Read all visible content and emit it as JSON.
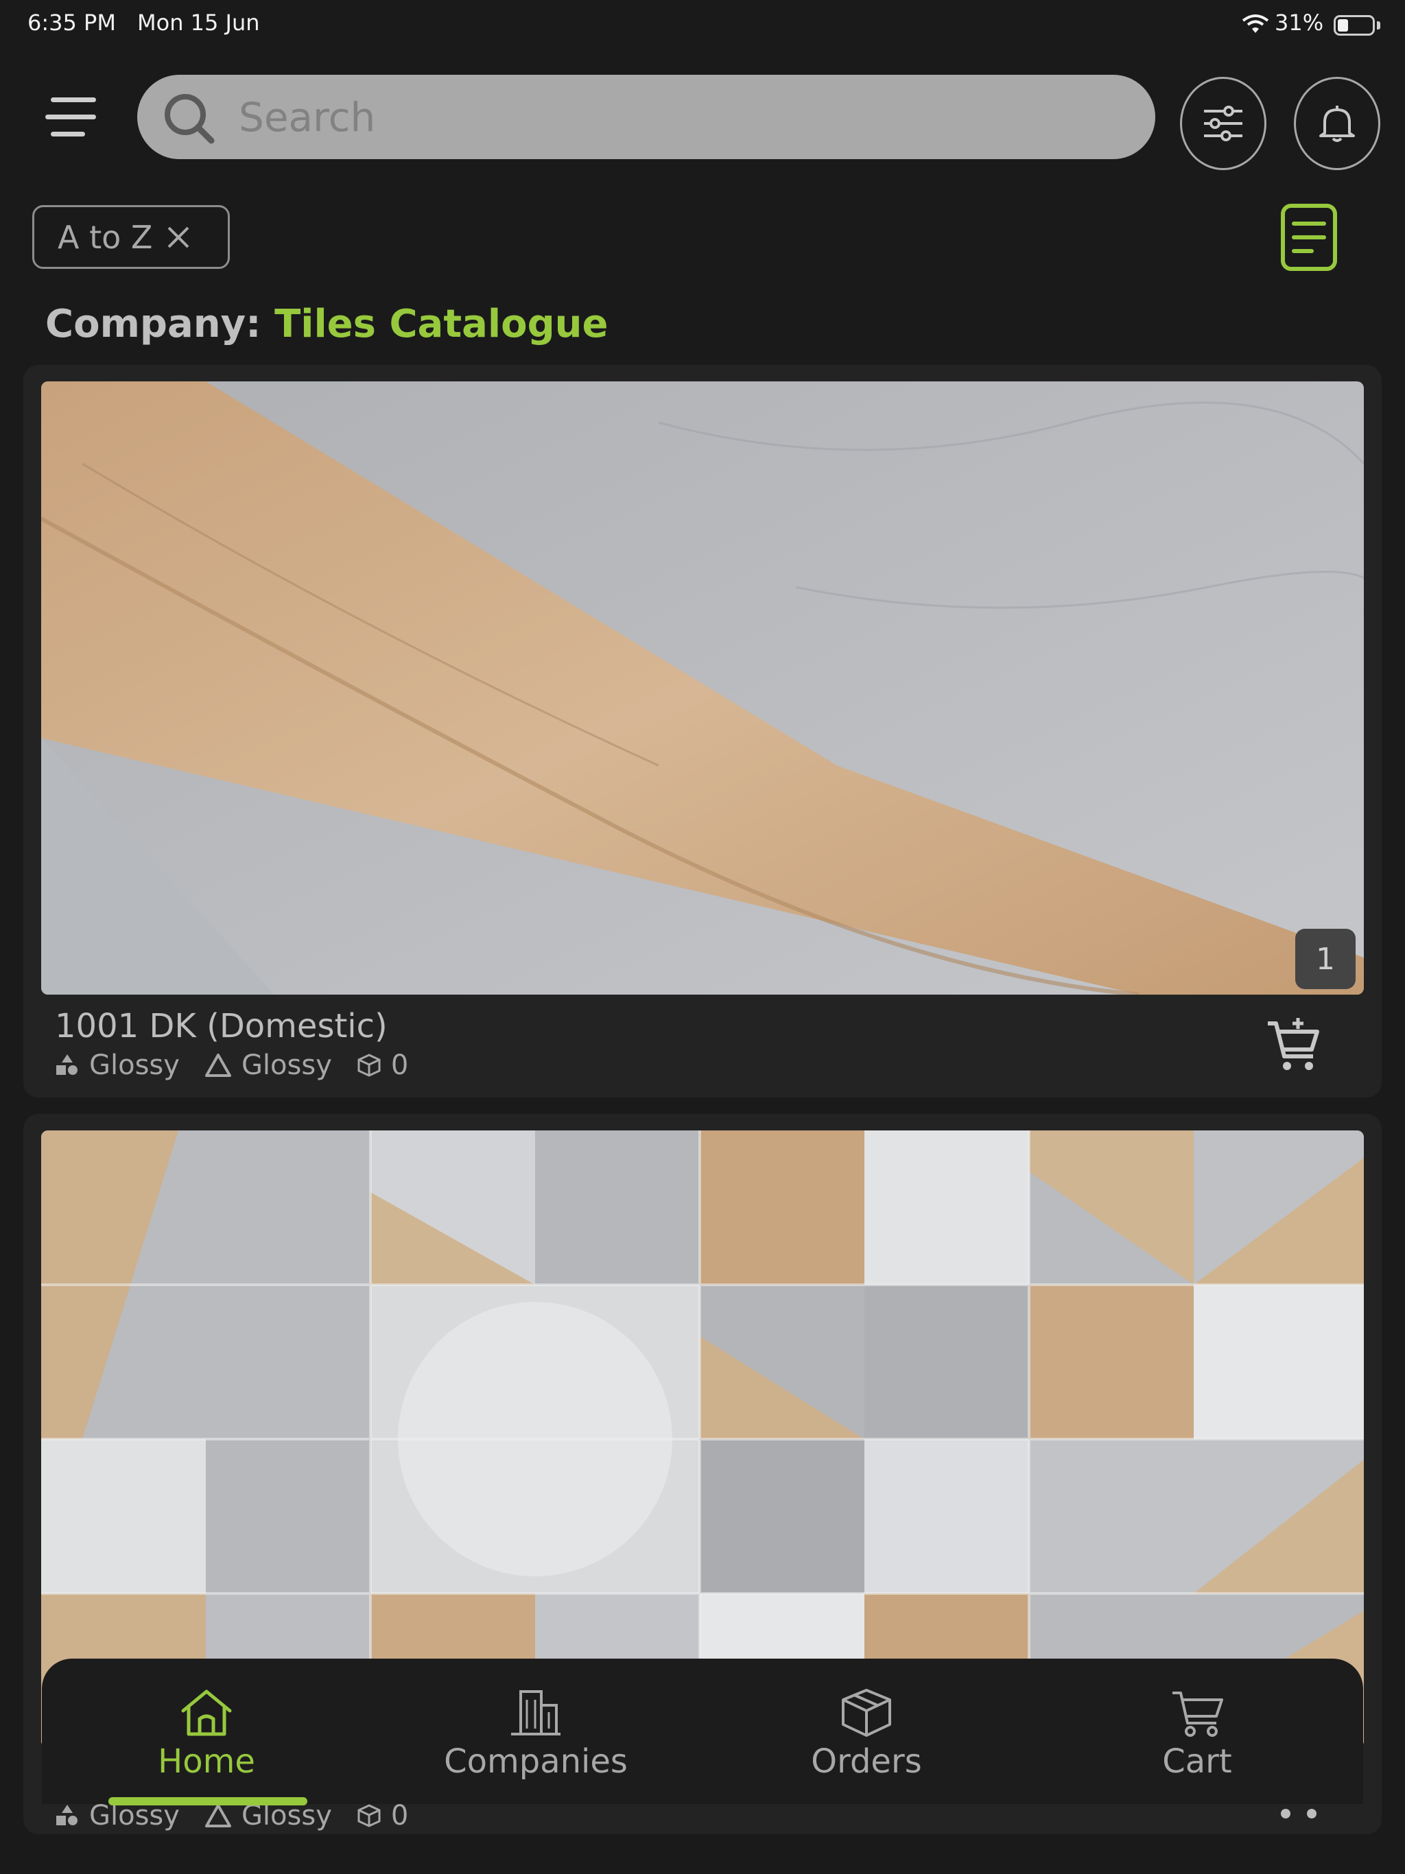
{
  "status_bar": {
    "time": "6:35 PM",
    "date": "Mon 15 Jun",
    "battery": "31%",
    "battery_level": 0.31
  },
  "header": {
    "search_placeholder": "Search"
  },
  "sort_chip": {
    "label": "A to Z"
  },
  "company": {
    "prefix": "Company:",
    "name": "Tiles Catalogue"
  },
  "products": [
    {
      "name": "1001 DK (Domestic)",
      "image_count": "1",
      "finish_1": "Glossy",
      "finish_2": "Glossy",
      "boxes": "0"
    },
    {
      "finish_1": "Glossy",
      "finish_2": "Glossy",
      "boxes": "0"
    }
  ],
  "nav": {
    "items": [
      {
        "label": "Home",
        "icon": "home-icon"
      },
      {
        "label": "Companies",
        "icon": "building-icon"
      },
      {
        "label": "Orders",
        "icon": "box-icon"
      },
      {
        "label": "Cart",
        "icon": "cart-icon"
      }
    ],
    "active": "Home"
  },
  "colors": {
    "accent": "#97c93d",
    "background": "#1a1a1b",
    "card": "#232324"
  }
}
